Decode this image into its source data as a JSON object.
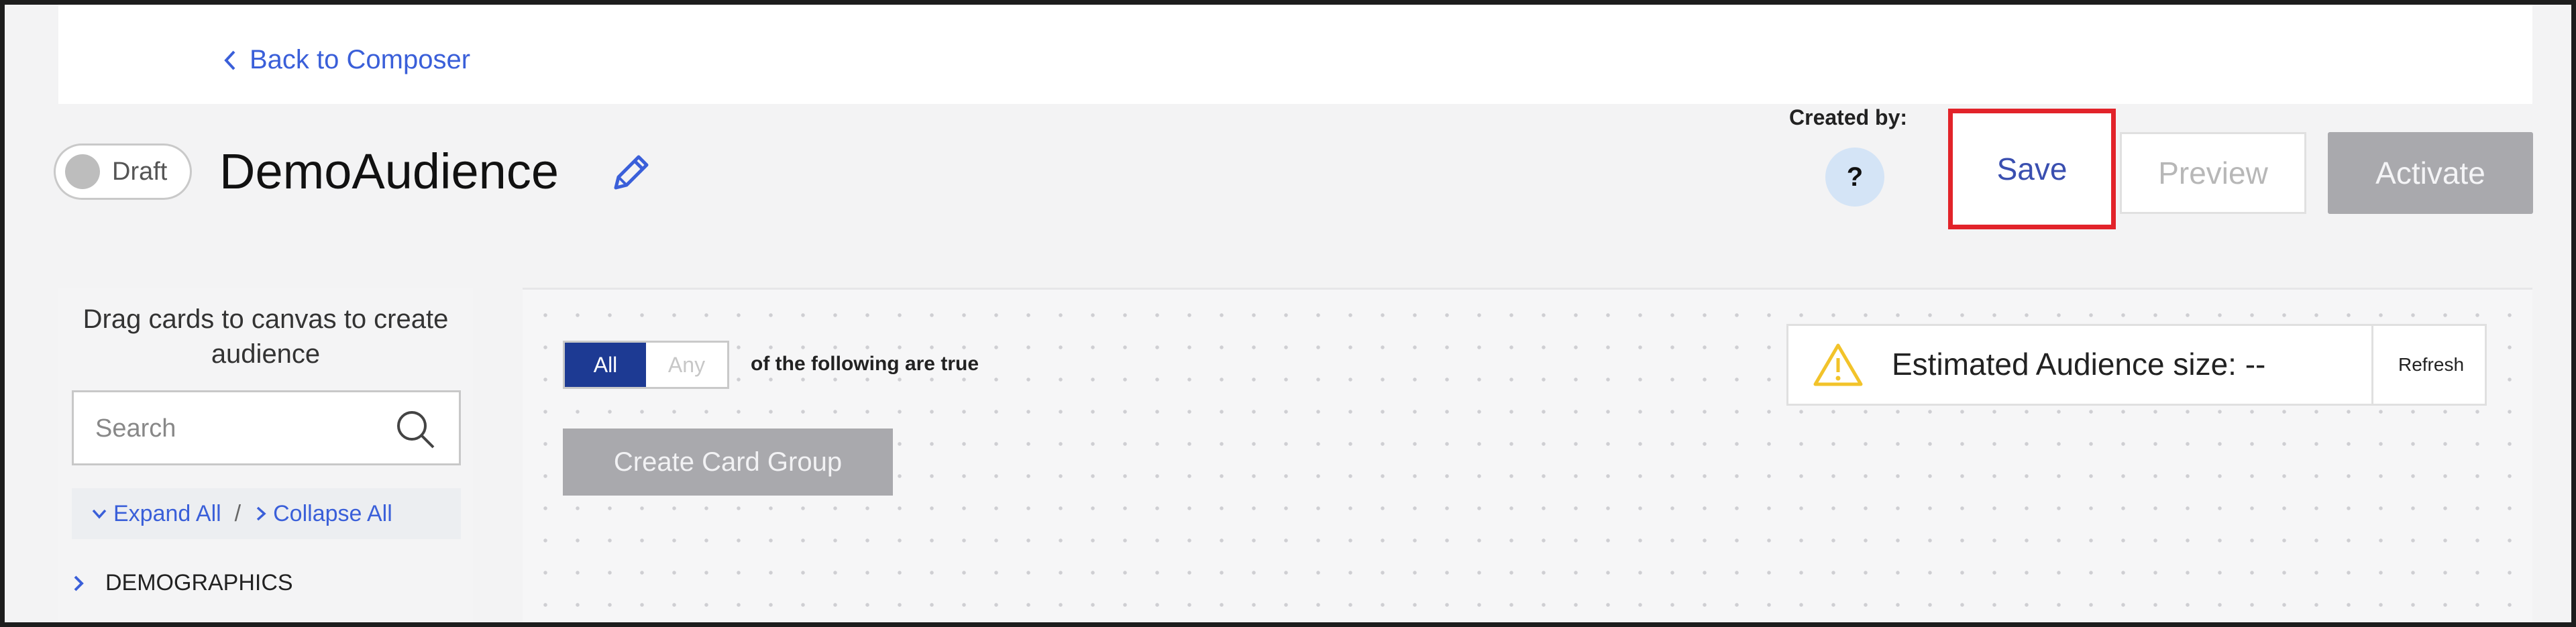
{
  "nav": {
    "back_label": "Back to Composer"
  },
  "header": {
    "status_label": "Draft",
    "title": "DemoAudience",
    "created_by_label": "Created by:",
    "creator_badge": "?",
    "save_label": "Save",
    "preview_label": "Preview",
    "activate_label": "Activate"
  },
  "sidebar": {
    "hint": "Drag cards to canvas to create audience",
    "search_placeholder": "Search",
    "expand_all": "Expand All",
    "separator": "/",
    "collapse_all": "Collapse All",
    "categories": [
      "DEMOGRAPHICS"
    ]
  },
  "canvas": {
    "match_options": [
      "All",
      "Any"
    ],
    "selected_match": "All",
    "condition_text": "of the following are true",
    "create_group_label": "Create Card Group"
  },
  "estimate": {
    "label": "Estimated Audience size: --",
    "refresh_label": "Refresh"
  },
  "colors": {
    "link": "#3a5fd9",
    "highlight_border": "#e2232a",
    "primary_toggle": "#1d3a93",
    "disabled_button": "#a9a9ad",
    "warning": "#f2c32a"
  }
}
